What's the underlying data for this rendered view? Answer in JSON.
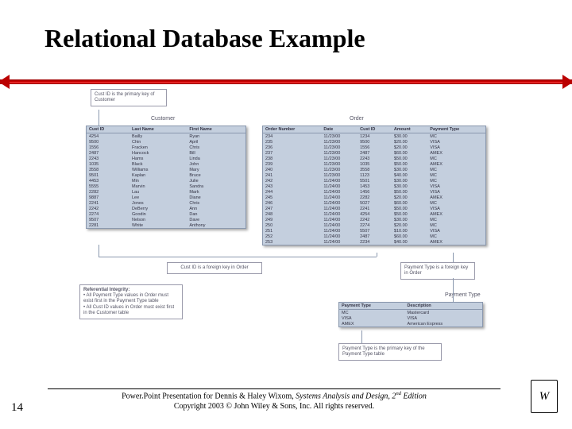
{
  "title": "Relational Database Example",
  "slide_number": "14",
  "footer": {
    "line1_a": "Power.Point Presentation for Dennis & Haley Wixom, ",
    "line1_b_italic": "Systems Analysis and Design, 2",
    "line1_sup": "nd",
    "line1_c_italic": " Edition",
    "line2": "Copyright 2003 © John Wiley & Sons, Inc.  All rights reserved."
  },
  "callouts": {
    "cust_pk": "Cust ID is the primary key of Customer",
    "cust_fk": "Cust ID is a foreign key in Order",
    "ref_integrity_head": "Referential Integrity:",
    "ref_integrity_b1": "All Payment Type values in Order must exist first in the Payment Type table",
    "ref_integrity_b2": "All Cust ID values in Order must exist first in the Customer table",
    "payment_fk": "Payment Type is a foreign key in Order",
    "payment_pk": "Payment Type is the primary key of the Payment Type table"
  },
  "labels": {
    "customer": "Customer",
    "order": "Order",
    "payment_type": "Payment Type"
  },
  "customer": {
    "headers": [
      "Cust ID",
      "Last Name",
      "First Name"
    ],
    "rows": [
      [
        "4254",
        "Bailly",
        "Ryan"
      ],
      [
        "9500",
        "Chin",
        "April"
      ],
      [
        "1556",
        "Fracken",
        "Chris"
      ],
      [
        "2487",
        "Hancock",
        "Bill"
      ],
      [
        "2243",
        "Hams",
        "Linda"
      ],
      [
        "1035",
        "Black",
        "John"
      ],
      [
        "3558",
        "Williams",
        "Mary"
      ],
      [
        "9501",
        "Kaplan",
        "Bruce"
      ],
      [
        "4453",
        "Min",
        "Julie"
      ],
      [
        "5555",
        "Marvin",
        "Sandra"
      ],
      [
        "2282",
        "Lau",
        "Mark"
      ],
      [
        "9887",
        "Lee",
        "Diane"
      ],
      [
        "2241",
        "Jones",
        "Chris"
      ],
      [
        "2242",
        "DeBerry",
        "Ann"
      ],
      [
        "2274",
        "Goodin",
        "Dan"
      ],
      [
        "9507",
        "Nelson",
        "Dave"
      ],
      [
        "2281",
        "White",
        "Anthony"
      ]
    ]
  },
  "order": {
    "headers": [
      "Order Number",
      "Date",
      "Cust ID",
      "Amount",
      "Payment Type"
    ],
    "rows": [
      [
        "234",
        "11/23/00",
        "1234",
        "$30.00",
        "MC"
      ],
      [
        "235",
        "11/23/00",
        "9500",
        "$20.00",
        "VISA"
      ],
      [
        "236",
        "11/23/00",
        "1556",
        "$20.00",
        "VISA"
      ],
      [
        "237",
        "11/23/00",
        "2487",
        "$60.00",
        "AMEX"
      ],
      [
        "238",
        "11/23/00",
        "2243",
        "$50.00",
        "MC"
      ],
      [
        "239",
        "11/23/00",
        "1035",
        "$50.00",
        "AMEX"
      ],
      [
        "240",
        "11/23/00",
        "3558",
        "$30.00",
        "MC"
      ],
      [
        "241",
        "11/23/00",
        "1123",
        "$40.00",
        "MC"
      ],
      [
        "242",
        "11/24/00",
        "5501",
        "$30.00",
        "MC"
      ],
      [
        "243",
        "11/24/00",
        "1453",
        "$30.00",
        "VISA"
      ],
      [
        "244",
        "11/24/00",
        "1456",
        "$50.00",
        "VISA"
      ],
      [
        "245",
        "11/24/00",
        "2282",
        "$20.00",
        "AMEX"
      ],
      [
        "246",
        "11/24/00",
        "5027",
        "$60.00",
        "MC"
      ],
      [
        "247",
        "11/24/00",
        "2241",
        "$50.00",
        "VISA"
      ],
      [
        "248",
        "11/24/00",
        "4254",
        "$50.00",
        "AMEX"
      ],
      [
        "249",
        "11/24/00",
        "2242",
        "$30.00",
        "MC"
      ],
      [
        "250",
        "11/24/00",
        "2274",
        "$20.00",
        "MC"
      ],
      [
        "251",
        "11/24/00",
        "5507",
        "$10.00",
        "VISA"
      ],
      [
        "252",
        "11/24/00",
        "2487",
        "$60.00",
        "MC"
      ],
      [
        "253",
        "11/24/00",
        "2234",
        "$40.00",
        "AMEX"
      ]
    ]
  },
  "payment_type": {
    "headers": [
      "Payment Type",
      "Description"
    ],
    "rows": [
      [
        "MC",
        "Mastercard"
      ],
      [
        "VISA",
        "VISA"
      ],
      [
        "AMEX",
        "American Express"
      ]
    ]
  }
}
